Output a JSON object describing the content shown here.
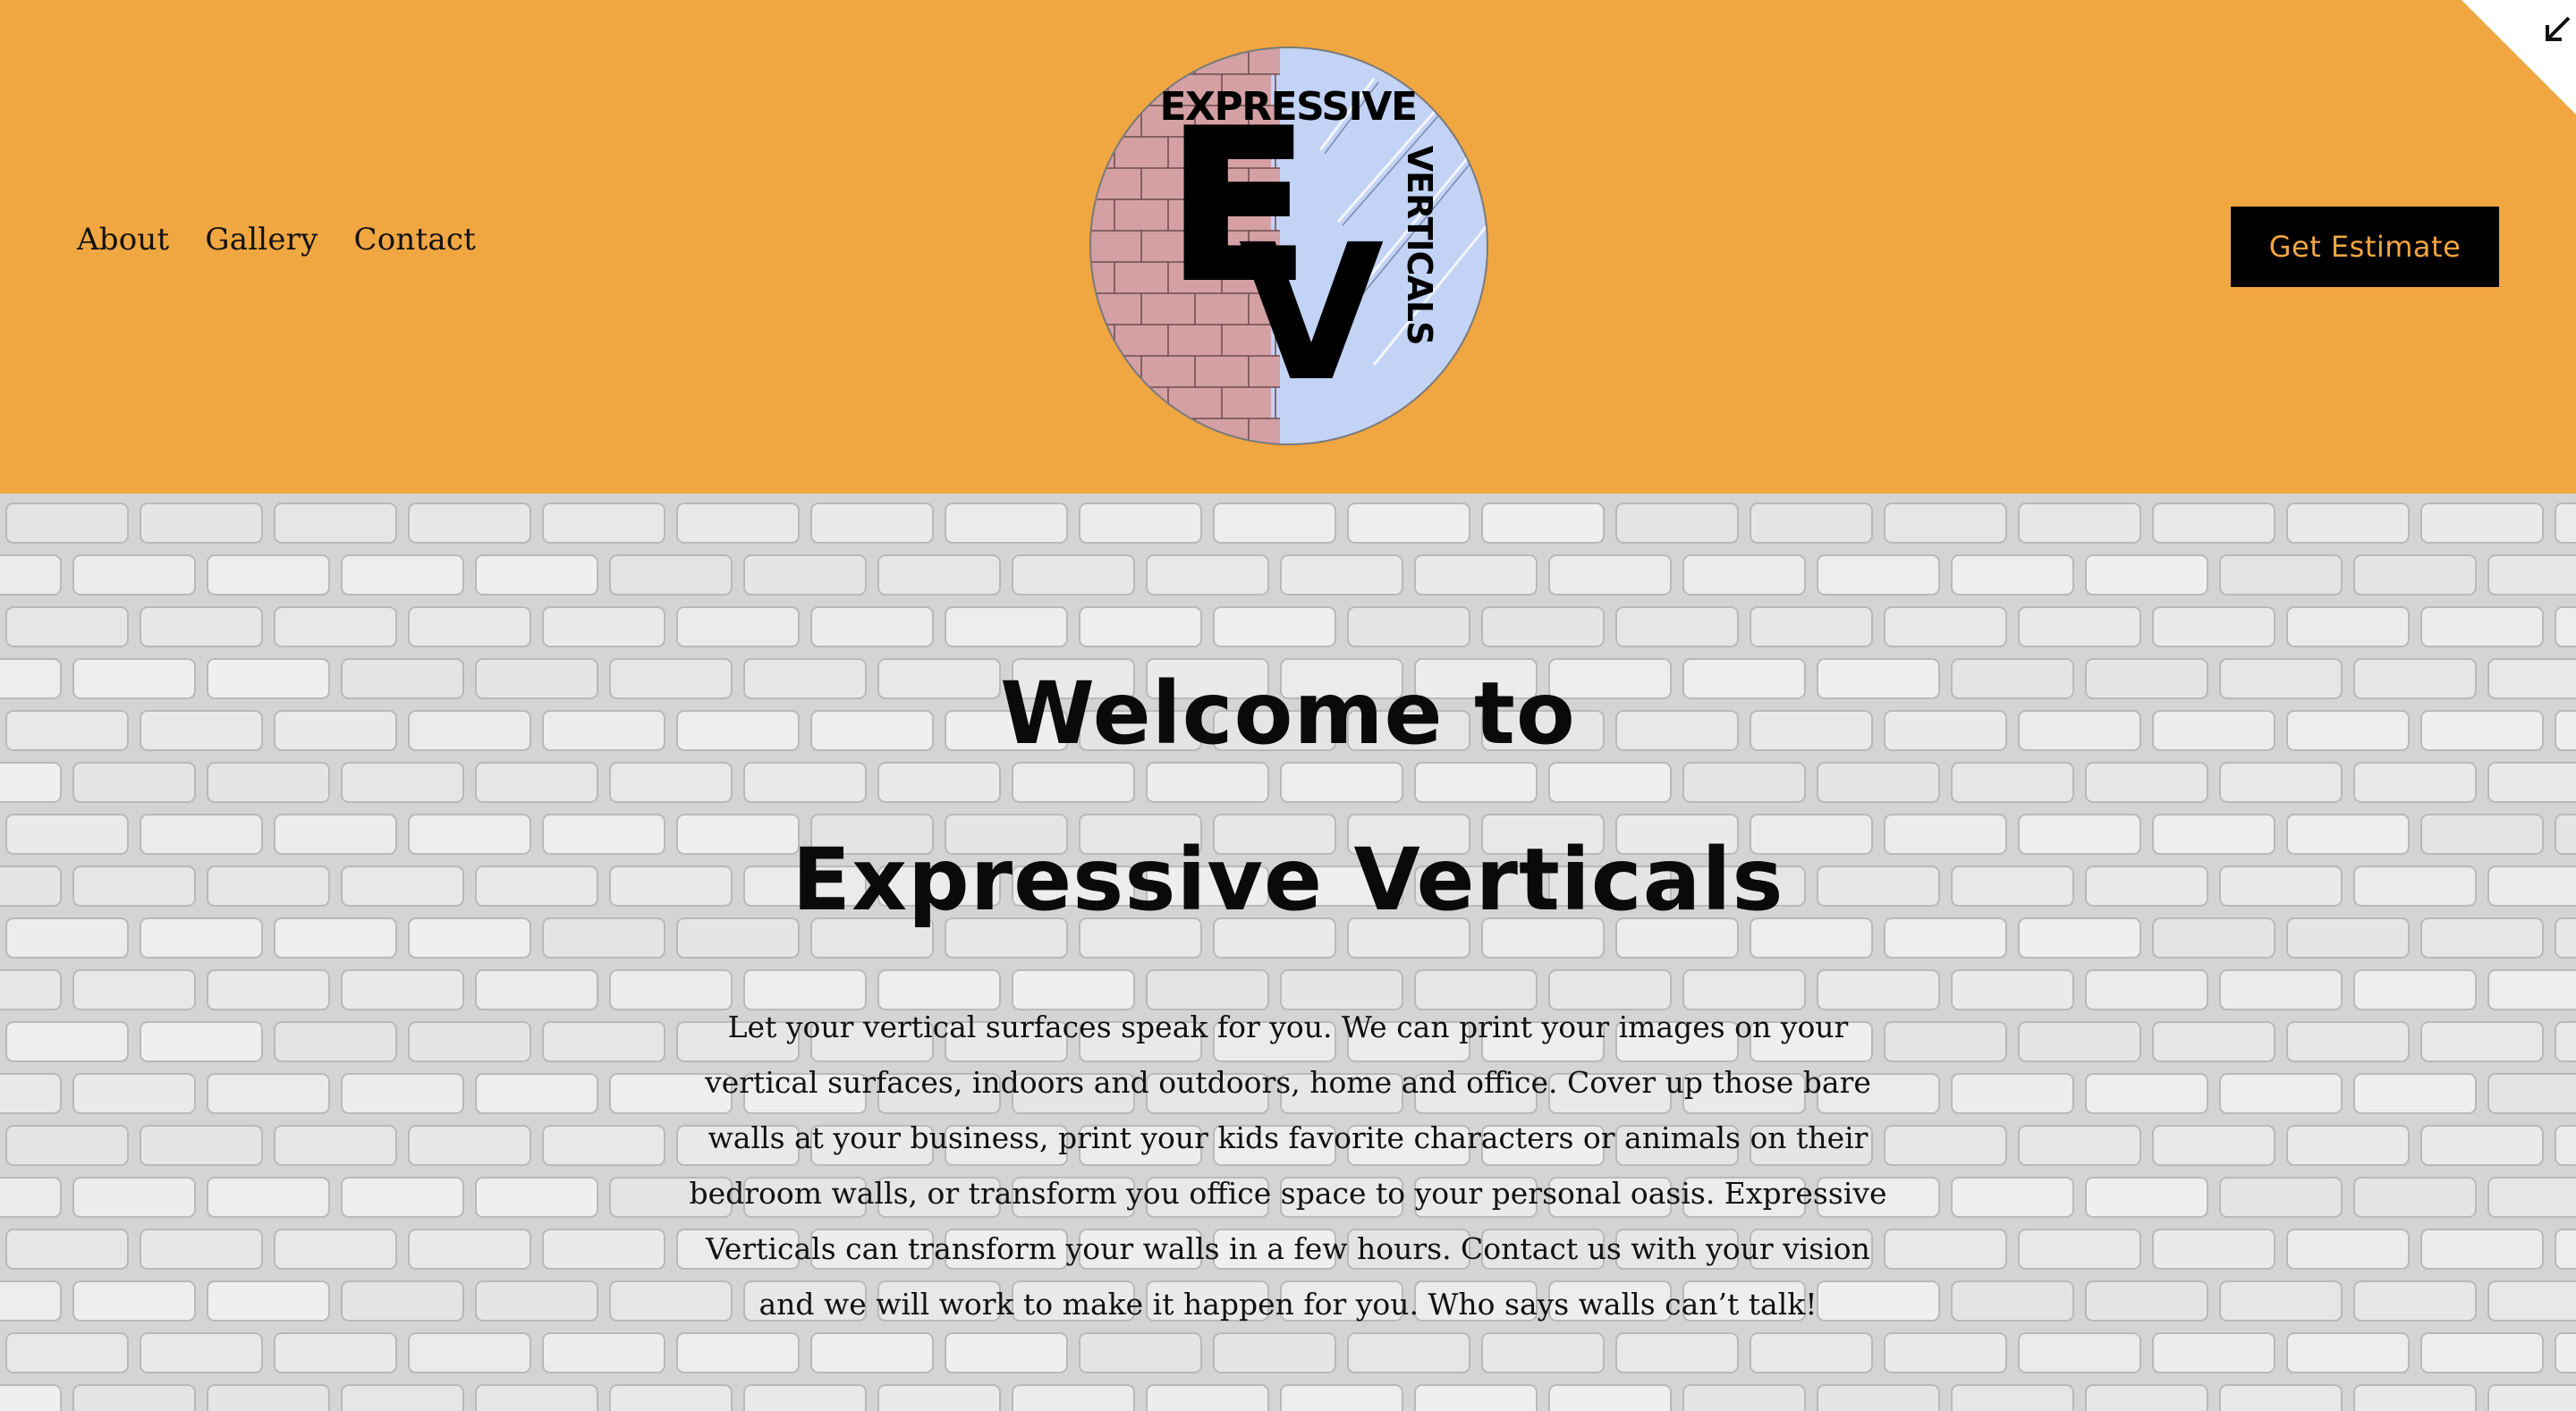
{
  "header": {
    "nav": [
      "About",
      "Gallery",
      "Contact"
    ],
    "cta_label": "Get Estimate",
    "logo": {
      "top_text": "EXPRESSIVE",
      "side_text": "VERTICALS",
      "monogram_e": "E",
      "monogram_v": "V"
    },
    "corner_icon": "arrow-down-left-icon"
  },
  "hero": {
    "title_line1": "Welcome to",
    "title_line2": "Expressive Verticals",
    "body": "Let your vertical surfaces speak for you. We can print your images on your vertical surfaces, indoors and outdoors, home and office. Cover up those bare walls at your business, print your kids favorite characters or animals on their bedroom walls, or transform you office space to your personal oasis. Expressive Verticals can transform your walls in a few hours. Contact us with your vision and we will work to make it happen for you. Who says walls can’t talk!"
  },
  "colors": {
    "header_bg": "#f0a641",
    "cta_bg": "#000000",
    "cta_text": "#f0a641",
    "logo_brick": "#d4a0a4",
    "logo_glass": "#c3d3f5",
    "hero_bg": "#d4d4d4"
  }
}
